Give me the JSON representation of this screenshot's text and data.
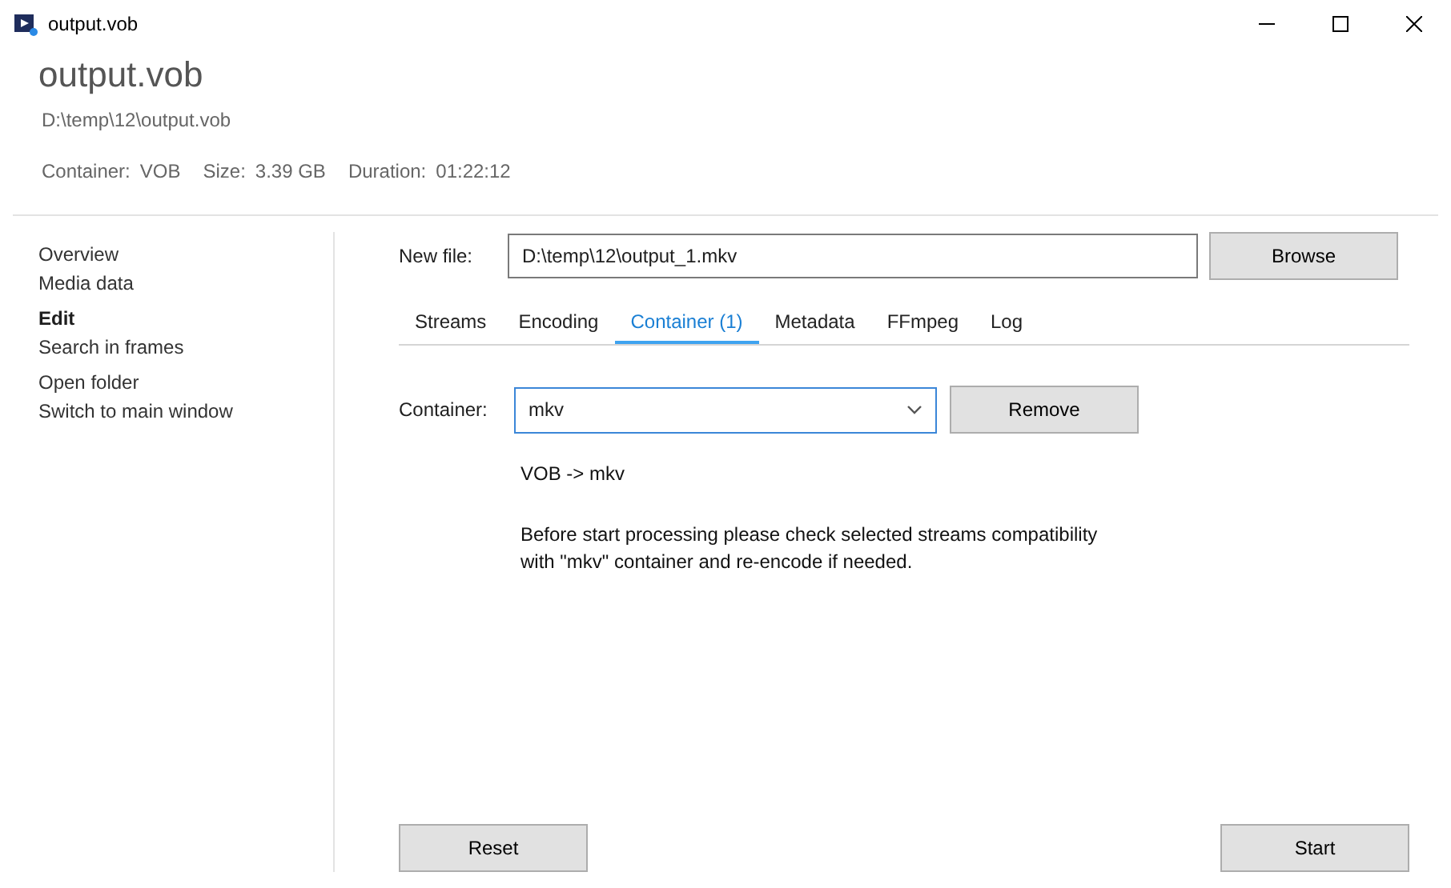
{
  "window": {
    "title": "output.vob"
  },
  "header": {
    "title": "output.vob",
    "path": "D:\\temp\\12\\output.vob",
    "info": [
      {
        "label": "Container:",
        "value": "VOB"
      },
      {
        "label": "Size:",
        "value": "3.39 GB"
      },
      {
        "label": "Duration:",
        "value": "01:22:12"
      }
    ]
  },
  "sidebar": {
    "groups": [
      [
        {
          "label": "Overview",
          "selected": false
        },
        {
          "label": "Media data",
          "selected": false
        }
      ],
      [
        {
          "label": "Edit",
          "selected": true
        },
        {
          "label": "Search in frames",
          "selected": false
        }
      ],
      [
        {
          "label": "Open folder",
          "selected": false
        },
        {
          "label": "Switch to main window",
          "selected": false
        }
      ]
    ]
  },
  "new_file": {
    "label": "New file:",
    "value": "D:\\temp\\12\\output_1.mkv",
    "button": "Browse"
  },
  "tabs": [
    {
      "label": "Streams",
      "selected": false
    },
    {
      "label": "Encoding",
      "selected": false
    },
    {
      "label": "Container (1)",
      "selected": true
    },
    {
      "label": "Metadata",
      "selected": false
    },
    {
      "label": "FFmpeg",
      "selected": false
    },
    {
      "label": "Log",
      "selected": false
    }
  ],
  "container": {
    "label": "Container:",
    "value": "mkv",
    "button": "Remove",
    "conversion": "VOB -> mkv",
    "message_lines": [
      "Before start processing please check selected streams compatibility",
      "with \"mkv\" container and re-encode if needed."
    ]
  },
  "footer_buttons": [
    "Reset",
    "Start"
  ]
}
